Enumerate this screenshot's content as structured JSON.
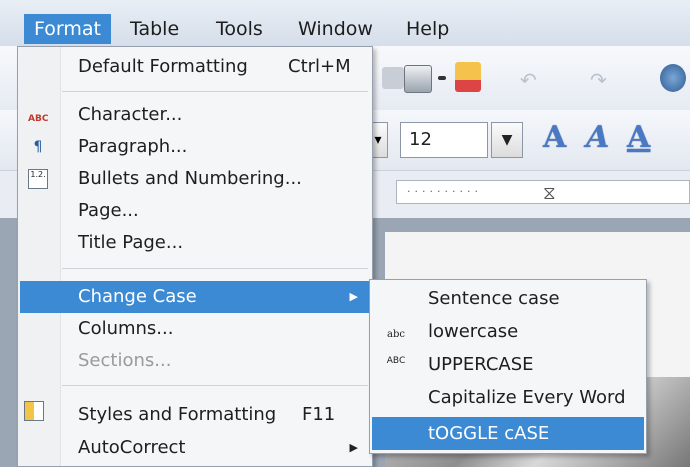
{
  "menubar": {
    "items": [
      {
        "label": "Format",
        "active": true
      },
      {
        "label": "Table"
      },
      {
        "label": "Tools"
      },
      {
        "label": "Window"
      },
      {
        "label": "Help"
      }
    ]
  },
  "toolbar": {
    "font_size": "12",
    "style_letters": [
      "A",
      "A",
      "A"
    ]
  },
  "format_menu": {
    "items": [
      {
        "label": "Default Formatting",
        "shortcut": "Ctrl+M"
      },
      {
        "label": "Character...",
        "icon": "character-icon"
      },
      {
        "label": "Paragraph...",
        "icon": "paragraph-icon"
      },
      {
        "label": "Bullets and Numbering...",
        "icon": "bullets-numbering-icon"
      },
      {
        "label": "Page..."
      },
      {
        "label": "Title Page..."
      },
      {
        "label": "Change Case",
        "highlighted": true,
        "submenu": true
      },
      {
        "label": "Columns..."
      },
      {
        "label": "Sections...",
        "disabled": true
      },
      {
        "label": "Styles and Formatting",
        "shortcut": "F11",
        "icon": "styles-formatting-icon"
      },
      {
        "label": "AutoCorrect",
        "submenu": true
      }
    ]
  },
  "case_menu": {
    "items": [
      {
        "label": "Sentence case"
      },
      {
        "label": "lowercase",
        "icon": "lowercase-icon",
        "icon_text": "abc"
      },
      {
        "label": "UPPERCASE",
        "icon": "uppercase-icon",
        "icon_text": "ABC"
      },
      {
        "label": "Capitalize Every Word"
      },
      {
        "label": "tOGGLE cASE",
        "highlighted": true
      }
    ]
  },
  "colors": {
    "highlight": "#3c8ad4",
    "menu_bg": "#f5f6f7"
  }
}
